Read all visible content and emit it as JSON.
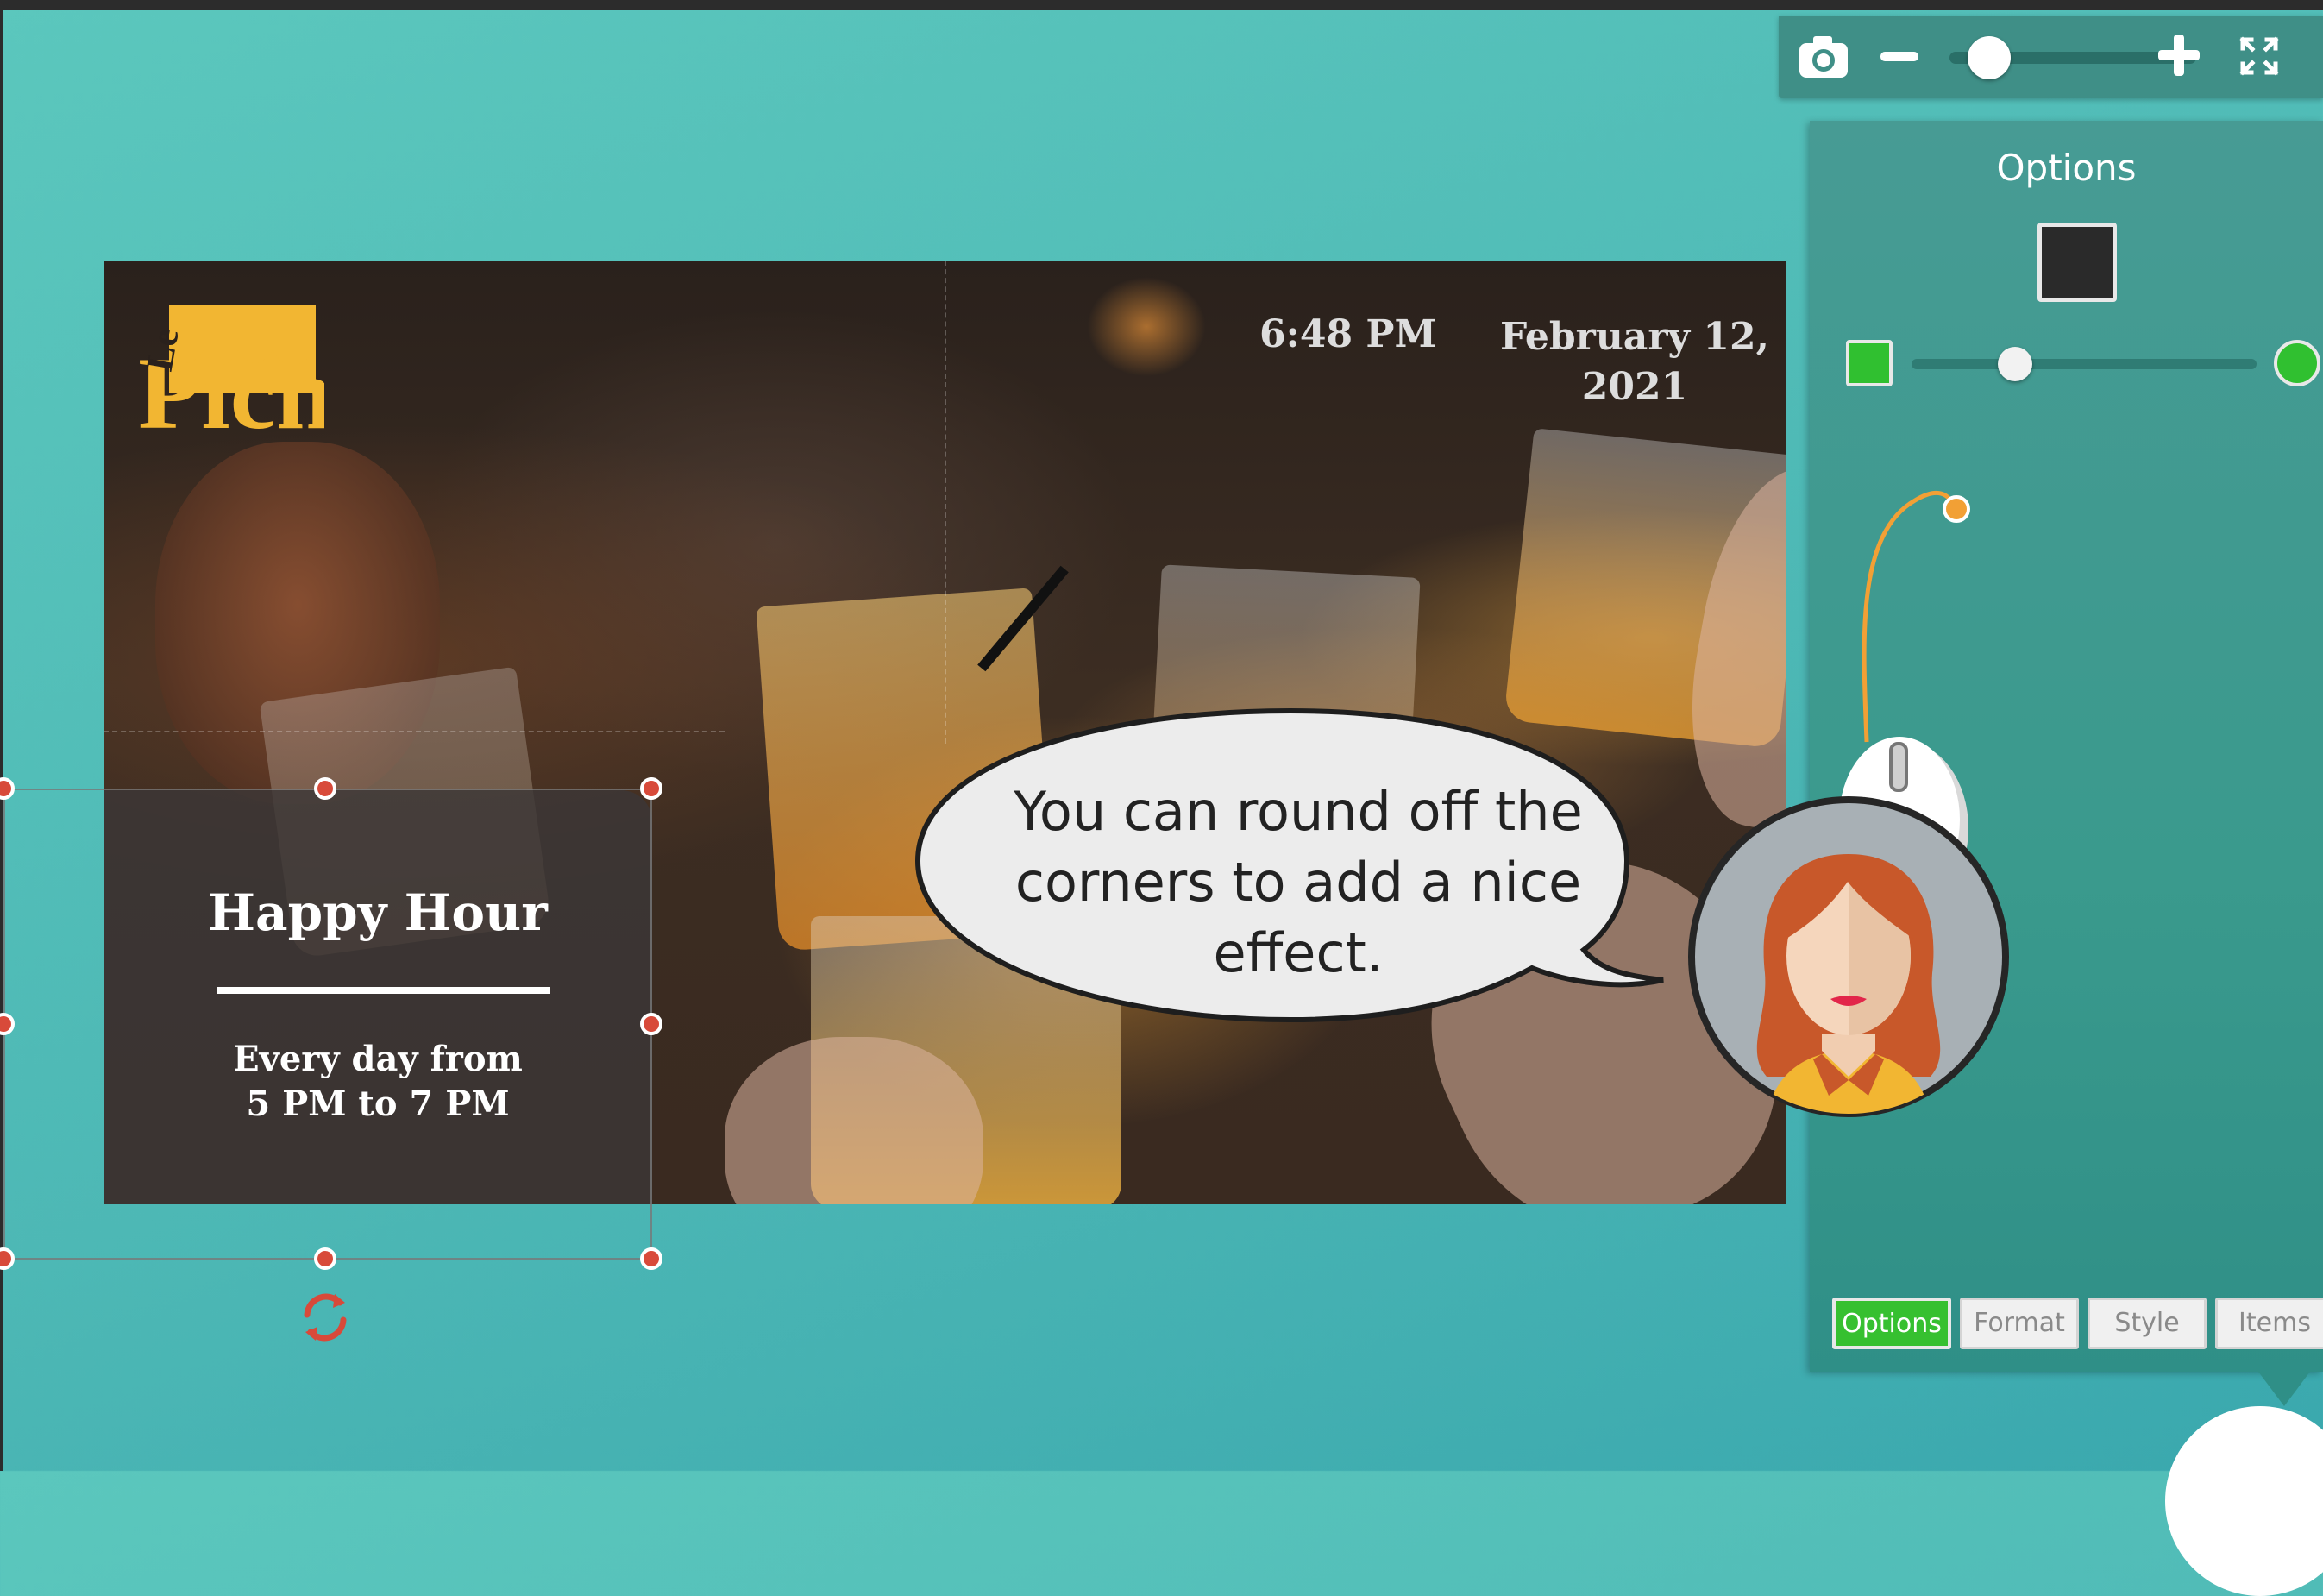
{
  "toolbar": {
    "icons": [
      "camera-icon",
      "zoom-out-icon",
      "zoom-slider",
      "zoom-in-icon",
      "fullscreen-icon"
    ],
    "zoom_level": 0.12
  },
  "panel": {
    "title": "Options",
    "color_swatch": "#2a2a2a",
    "corner_slider": {
      "value": 0.18,
      "min_icon": "square-corner-icon",
      "max_icon": "round-corner-icon"
    },
    "tabs": [
      {
        "label": "Options",
        "active": true
      },
      {
        "label": "Format",
        "active": false
      },
      {
        "label": "Style",
        "active": false
      },
      {
        "label": "Items",
        "active": false
      }
    ]
  },
  "slide": {
    "logo": {
      "line1": "Le",
      "line2": "Pichet"
    },
    "time": "6:48 PM",
    "date_line1": "February 12,",
    "date_line2": "2021",
    "info": {
      "title": "Happy Hour",
      "line1": "Every day from",
      "line2": "5 PM to 7 PM"
    }
  },
  "tutorial": {
    "line1": "You can round off the",
    "line2": "corners to add a nice",
    "line3": "effect."
  },
  "colors": {
    "background": "#4db8b5",
    "panel": "#3a9a8d",
    "active_tab": "#36c030",
    "handle": "#d84a3a",
    "logo_yellow": "#f2b632"
  }
}
